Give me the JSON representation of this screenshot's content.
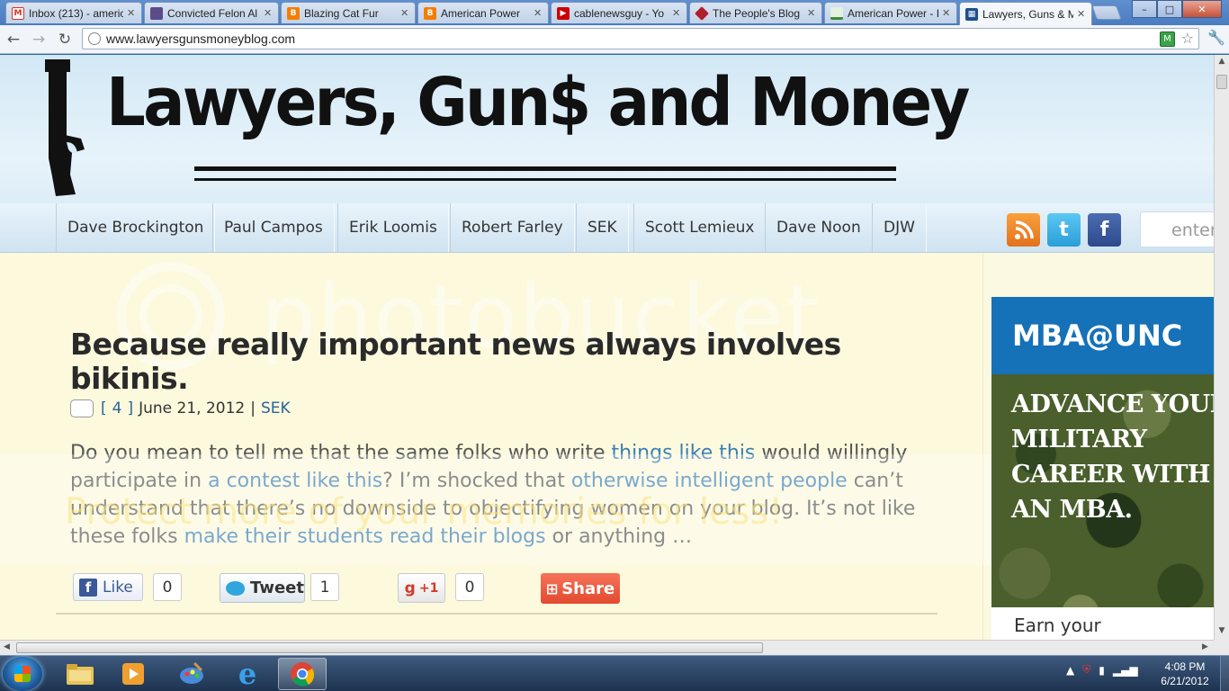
{
  "browser": {
    "tabs": [
      {
        "title": "Inbox (213) - americ",
        "icon": "gmail-icon",
        "color": "#d93025"
      },
      {
        "title": "Convicted Felon Al",
        "icon": "site-icon",
        "color": "#5b4b8a"
      },
      {
        "title": "Blazing Cat Fur",
        "icon": "blogger-icon",
        "color": "#f57d00"
      },
      {
        "title": "American Power",
        "icon": "blogger-icon",
        "color": "#f57d00"
      },
      {
        "title": "cablenewsguy - Yo",
        "icon": "youtube-icon",
        "color": "#cc0000"
      },
      {
        "title": "The People's Blog I",
        "icon": "diamond-icon",
        "color": "#b01e2e"
      },
      {
        "title": "American Power - I",
        "icon": "chart-icon",
        "color": "#3c8a3c"
      },
      {
        "title": "Lawyers, Guns & M",
        "icon": "grid-icon",
        "color": "#1b4f8f"
      }
    ],
    "url": "www.lawyersgunsmoneyblog.com",
    "window_controls": {
      "minimize": "–",
      "maximize": "□",
      "close": "✕"
    }
  },
  "site": {
    "logo": "Lawyers, Gun$ and Money",
    "nav": [
      "Dave Brockington",
      "Paul Campos",
      "Erik Loomis",
      "Robert Farley",
      "SEK",
      "Scott Lemieux",
      "Dave Noon",
      "DJW"
    ],
    "search_placeholder": "enter"
  },
  "watermark": "photobucket",
  "strip_text": "Protect more of your memories for less!",
  "post": {
    "title": "Because really important news always involves bikinis.",
    "comment_count": "4",
    "comments_open": "[",
    "comments_close": "]",
    "date": "June 21, 2012",
    "separator": "|",
    "author": "SEK",
    "excerpt": {
      "p1": "Do you mean to tell me that the same folks who write ",
      "l1": "things like this",
      "p2": " would willingly participate in ",
      "l2": "a contest like this",
      "p3": "? I’m shocked that ",
      "l3": "otherwise intelligent people",
      "p4": " can’t understand that there’s no downside to objectifying women on your blog. It’s not like these folks ",
      "l4": "make their students read their blogs",
      "p5": " or anything …"
    },
    "share": {
      "facebook_label": "Like",
      "facebook_count": "0",
      "tweet_label": "Tweet",
      "tweet_count": "1",
      "gplus_label": "+1",
      "gplus_count": "0",
      "share_label": "Share"
    }
  },
  "ad": {
    "brand": "MBA@UNC",
    "headline_lines": [
      "ADVANCE YOUR",
      "MILITARY",
      "CAREER WITH",
      "AN MBA."
    ],
    "footer": "Earn your"
  },
  "taskbar": {
    "time": "4:08 PM",
    "date": "6/21/2012"
  }
}
